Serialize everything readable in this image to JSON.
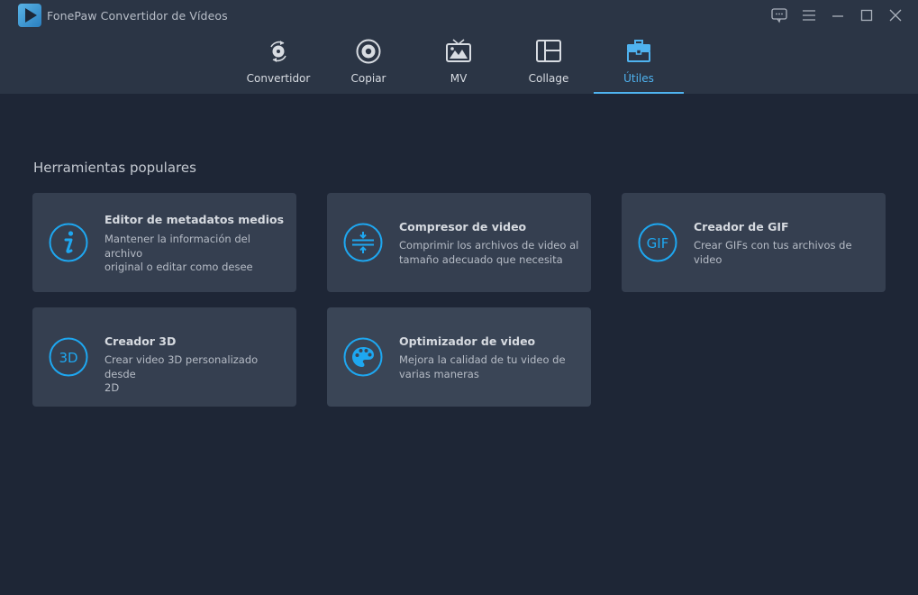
{
  "app": {
    "title": "FonePaw Convertidor de Vídeos",
    "logo_icon": "play-logo-icon"
  },
  "window_controls": [
    {
      "name": "feedback-icon"
    },
    {
      "name": "menu-icon"
    },
    {
      "name": "minimize-icon"
    },
    {
      "name": "maximize-icon"
    },
    {
      "name": "close-icon"
    }
  ],
  "tabs": [
    {
      "label": "Convertidor",
      "icon": "convert-icon",
      "active": false
    },
    {
      "label": "Copiar",
      "icon": "disc-icon",
      "active": false
    },
    {
      "label": "MV",
      "icon": "tv-image-icon",
      "active": false
    },
    {
      "label": "Collage",
      "icon": "collage-layout-icon",
      "active": false
    },
    {
      "label": "Útiles",
      "icon": "toolbox-icon",
      "active": true
    }
  ],
  "section": {
    "title": "Herramientas populares"
  },
  "tools": [
    {
      "title": "Editor de metadatos medios",
      "description": [
        "Mantener la información del archivo",
        "original o editar como desee"
      ],
      "icon": "info-icon"
    },
    {
      "title": "Compresor de video",
      "description": [
        "Comprimir los archivos de video al",
        "tamaño adecuado que necesita"
      ],
      "icon": "compress-icon"
    },
    {
      "title": "Creador de GIF",
      "description": [
        "Crear GIFs con tus archivos de",
        "video"
      ],
      "icon": "gif-icon",
      "icon_text": "GIF"
    },
    {
      "title": "Creador 3D",
      "description": [
        "Crear video 3D personalizado desde",
        "2D"
      ],
      "icon": "3d-icon",
      "icon_text": "3D"
    },
    {
      "title": "Optimizador de video",
      "description": [
        "Mejora la calidad de tu video de",
        "varias maneras"
      ],
      "icon": "palette-icon"
    }
  ],
  "colors": {
    "accent": "#4fb3f0",
    "icon_blue": "#1ea7f0",
    "header_bg": "#2b3545",
    "body_bg": "#1e2636",
    "card_bg": "#353f50"
  }
}
